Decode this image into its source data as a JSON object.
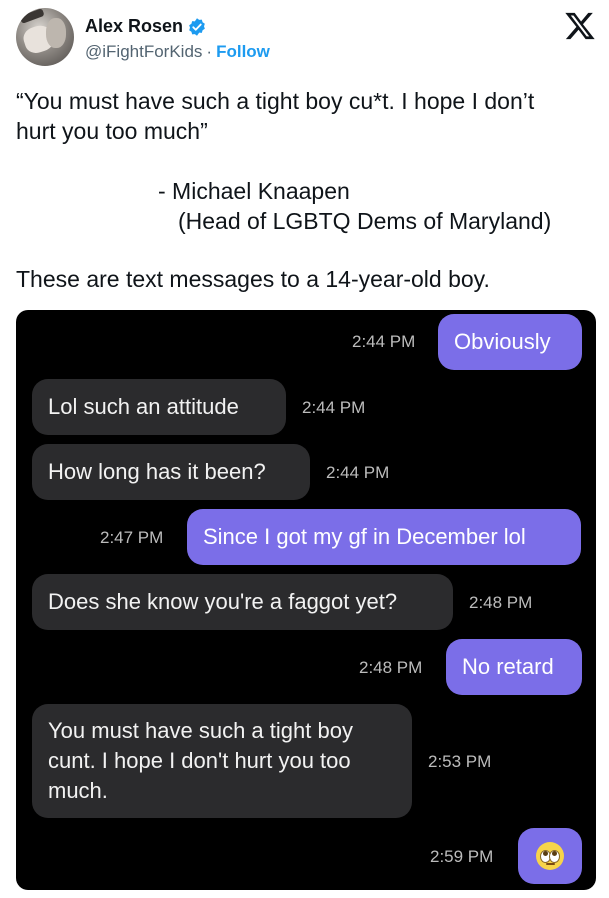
{
  "author": {
    "name": "Alex Rosen",
    "handle": "@iFightForKids",
    "separator": "·",
    "follow_label": "Follow"
  },
  "tweet": {
    "quote_line1": "“You must have such a tight boy cu*t. I hope I don’t",
    "quote_line2": "hurt you too much”",
    "attribution_line1": "- Michael Knaapen",
    "attribution_line2": "(Head of LGBTQ Dems of Maryland)",
    "context": "These are text messages to a 14-year-old boy."
  },
  "messages": [
    {
      "side": "out",
      "text": "Obviously",
      "time": "2:44 PM"
    },
    {
      "side": "in",
      "text": "Lol such an attitude",
      "time": "2:44 PM"
    },
    {
      "side": "in",
      "text": "How long has it been?",
      "time": "2:44 PM"
    },
    {
      "side": "out",
      "text": "Since I got my gf in December lol",
      "time": "2:47 PM"
    },
    {
      "side": "in",
      "text": "Does she know you're a faggot yet?",
      "time": "2:48 PM"
    },
    {
      "side": "out",
      "text": "No retard",
      "time": "2:48 PM"
    },
    {
      "side": "in",
      "text_line1": "You must have such a tight boy",
      "text_line2": "cunt. I hope I don't hurt you too",
      "text_line3": "much.",
      "time": "2:53 PM"
    },
    {
      "side": "out",
      "emoji": "eye-roll-emoji",
      "time": "2:59 PM"
    }
  ],
  "colors": {
    "outgoing_bubble": "#7b6ee8",
    "incoming_bubble": "#2b2b2d",
    "chat_background": "#000000",
    "follow_link": "#1d9bf0",
    "verified_badge": "#1d9bf0"
  },
  "icons": {
    "verified": "verified-badge-icon",
    "platform": "x-logo-icon"
  }
}
